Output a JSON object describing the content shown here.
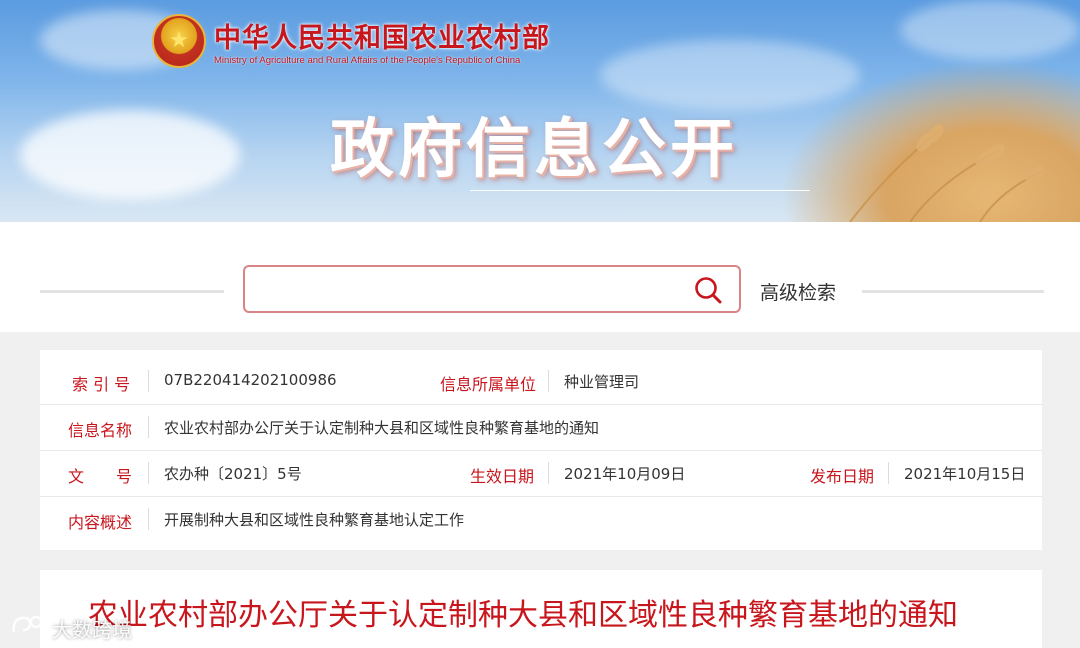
{
  "header": {
    "ministry_cn": "中华人民共和国农业农村部",
    "ministry_en": "Ministry of Agriculture and Rural Affairs of the People's Republic of China",
    "title": "政府信息公开",
    "emblem_icon": "national-emblem-icon"
  },
  "search": {
    "placeholder": "",
    "value": "",
    "icon": "search-icon",
    "advanced_label": "高级检索"
  },
  "info": {
    "index_label": "索 引 号",
    "index_value": "07B220414202100986",
    "unit_label": "信息所属单位",
    "unit_value": "种业管理司",
    "name_label": "信息名称",
    "name_value": "农业农村部办公厅关于认定制种大县和区域性良种繁育基地的通知",
    "doc_label": "文　　号",
    "doc_value": "农办种〔2021〕5号",
    "effective_label": "生效日期",
    "effective_value": "2021年10月09日",
    "publish_label": "发布日期",
    "publish_value": "2021年10月15日",
    "summary_label": "内容概述",
    "summary_value": "开展制种大县和区域性良种繁育基地认定工作"
  },
  "notice": {
    "title": "农业农村部办公厅关于认定制种大县和区域性良种繁育基地的通知"
  },
  "watermark": {
    "text": "大数跨境"
  },
  "colors": {
    "accent_red": "#c8161d",
    "search_border": "#d98585",
    "sky_blue": "#5b9be0",
    "wheat": "#d9a563"
  }
}
